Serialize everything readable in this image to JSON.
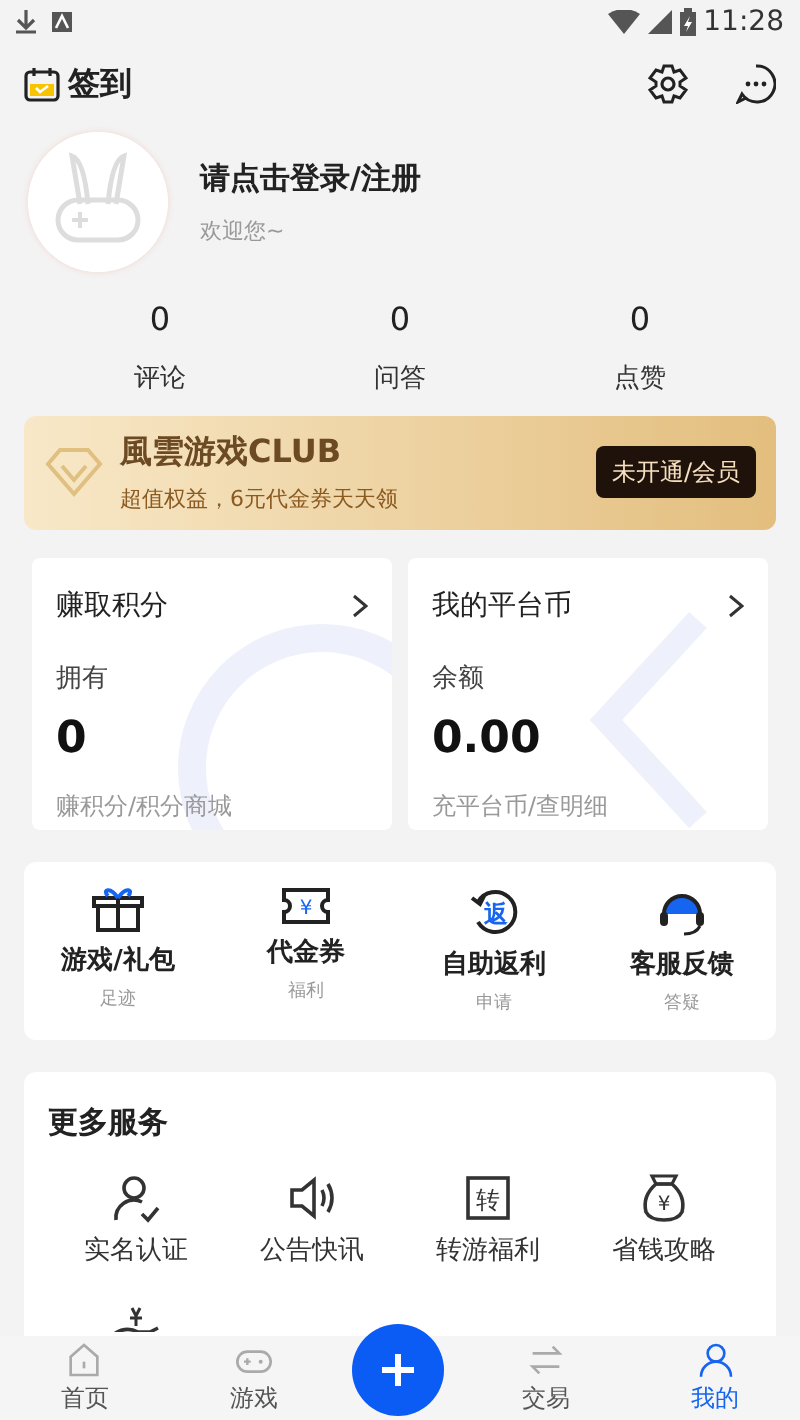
{
  "status_bar": {
    "time": "11:28"
  },
  "header": {
    "title": "签到"
  },
  "profile": {
    "name": "请点击登录/注册",
    "subtitle": "欢迎您~"
  },
  "stats": [
    {
      "value": "0",
      "label": "评论"
    },
    {
      "value": "0",
      "label": "问答"
    },
    {
      "value": "0",
      "label": "点赞"
    }
  ],
  "club": {
    "title": "風雲游戏CLUB",
    "subtitle": "超值权益，6元代金券天天领",
    "button": "未开通/会员"
  },
  "wallet_cards": [
    {
      "kind": "points",
      "title": "赚取积分",
      "label": "拥有",
      "value": "0",
      "link": "赚积分/积分商城"
    },
    {
      "kind": "coins",
      "title": "我的平台币",
      "label": "余额",
      "value": "0.00",
      "link": "充平台币/查明细"
    }
  ],
  "shortcuts": [
    {
      "kind": "gift",
      "label": "游戏/礼包",
      "caption": "足迹"
    },
    {
      "kind": "voucher",
      "label": "代金券",
      "caption": "福利",
      "icon_text": "¥"
    },
    {
      "kind": "rebate",
      "label": "自助返利",
      "caption": "申请",
      "icon_text": "返"
    },
    {
      "kind": "service",
      "label": "客服反馈",
      "caption": "答疑"
    }
  ],
  "more_services": {
    "title": "更多服务",
    "items": [
      {
        "kind": "verify",
        "label": "实名认证"
      },
      {
        "kind": "speaker",
        "label": "公告快讯"
      },
      {
        "kind": "transfer",
        "label": "转游福利",
        "icon_text": "转"
      },
      {
        "kind": "moneybag",
        "label": "省钱攻略",
        "icon_text": "¥"
      },
      {
        "kind": "hand"
      }
    ]
  },
  "bottom_nav": [
    {
      "kind": "home",
      "label": "首页",
      "selected": false
    },
    {
      "kind": "game",
      "label": "游戏",
      "selected": false
    },
    {
      "kind": "add",
      "selected": false
    },
    {
      "kind": "trade",
      "label": "交易",
      "selected": false
    },
    {
      "kind": "mine",
      "label": "我的",
      "selected": true
    }
  ]
}
